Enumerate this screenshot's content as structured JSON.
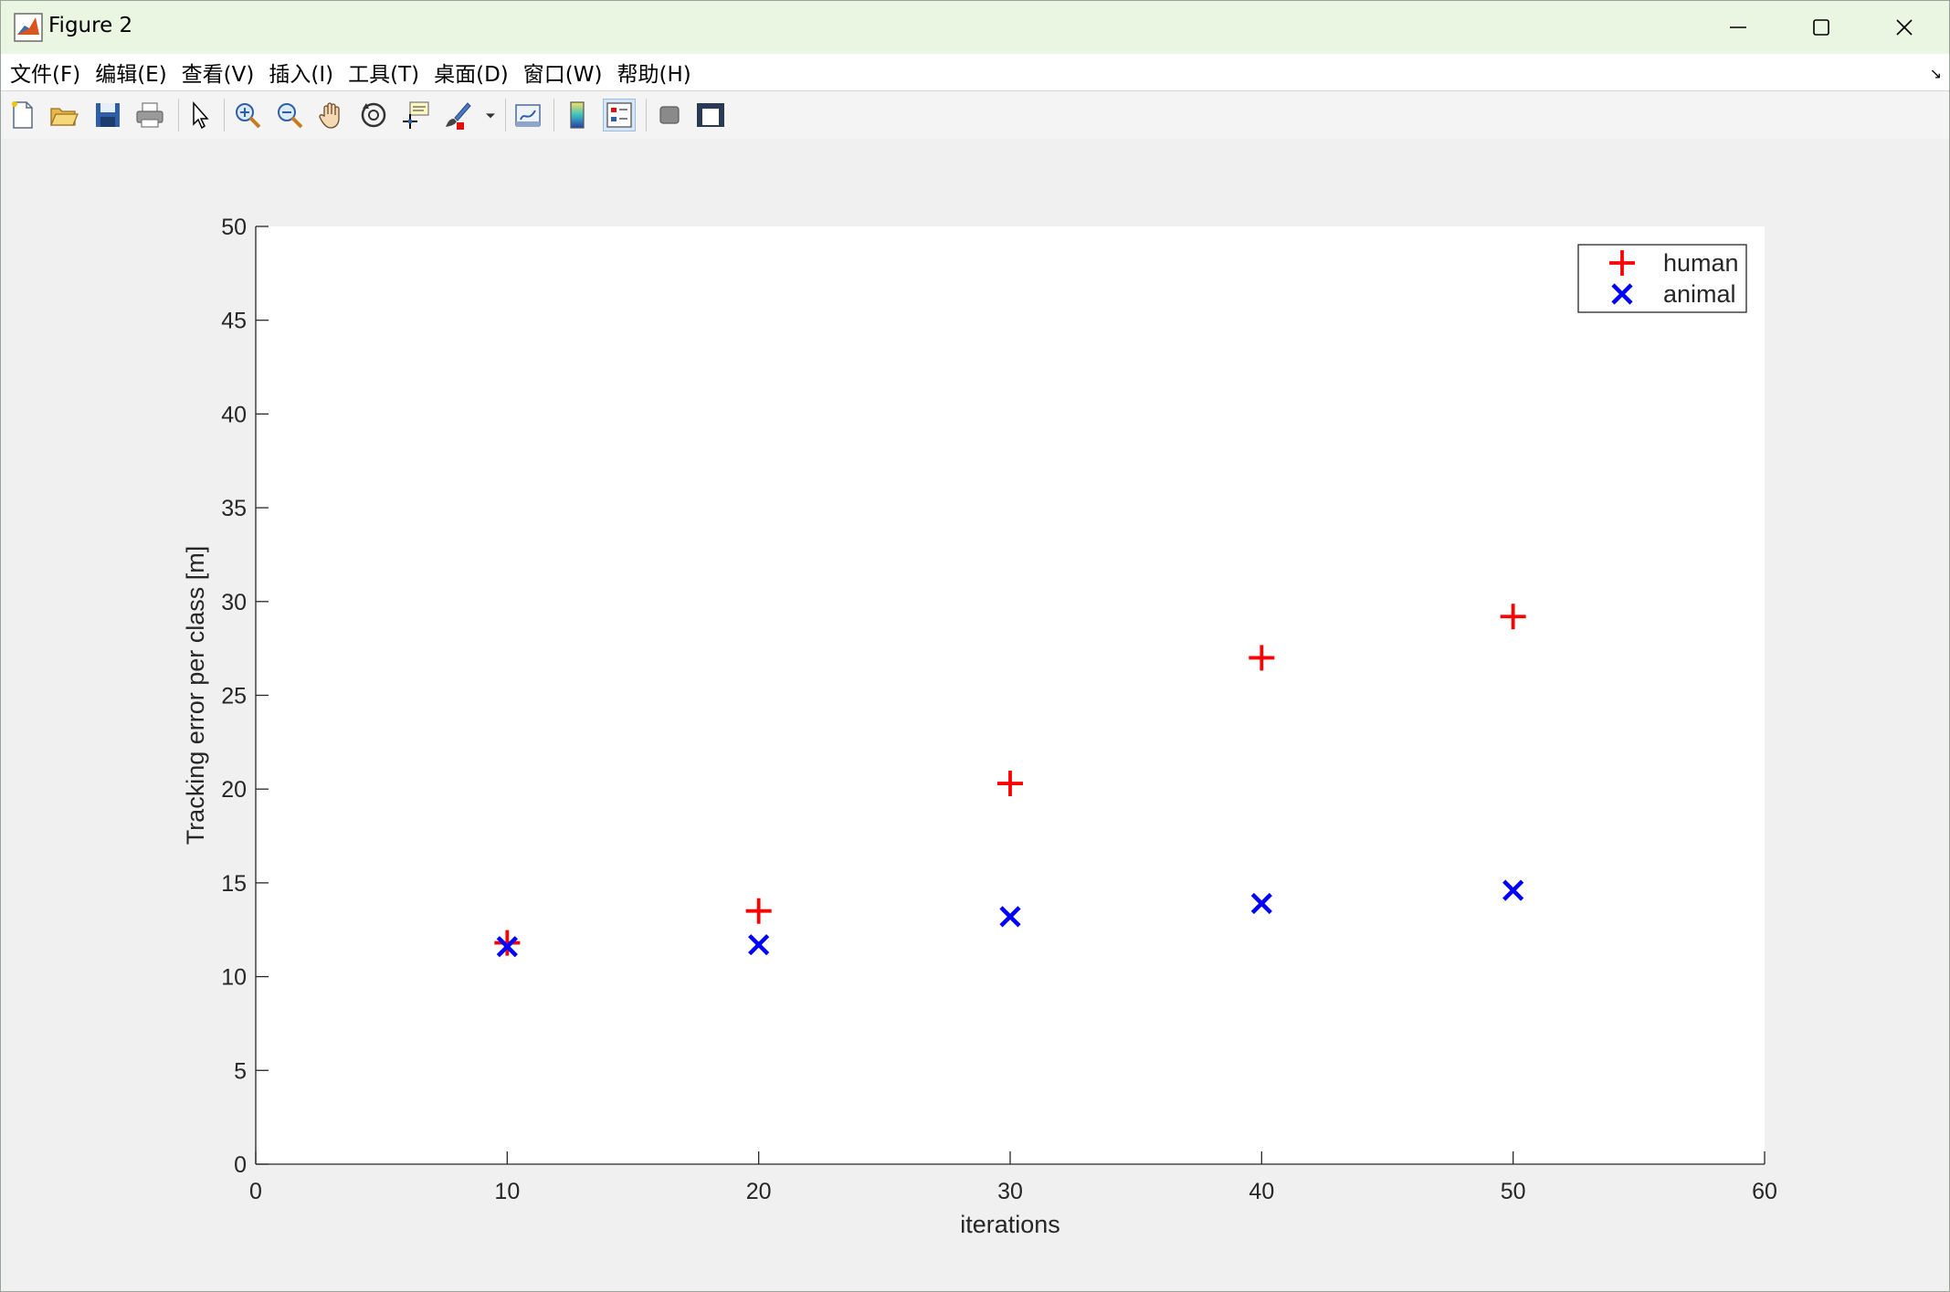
{
  "window": {
    "title": "Figure 2",
    "minimize_icon": "minimize-icon",
    "maximize_icon": "maximize-icon",
    "close_icon": "close-icon"
  },
  "menu": {
    "items": [
      {
        "label": "文件(F)"
      },
      {
        "label": "编辑(E)"
      },
      {
        "label": "查看(V)"
      },
      {
        "label": "插入(I)"
      },
      {
        "label": "工具(T)"
      },
      {
        "label": "桌面(D)"
      },
      {
        "label": "窗口(W)"
      },
      {
        "label": "帮助(H)"
      }
    ],
    "corner_glyph": "↘"
  },
  "toolbar": {
    "buttons": [
      {
        "icon": "new-figure-icon"
      },
      {
        "icon": "open-file-icon"
      },
      {
        "icon": "save-icon"
      },
      {
        "icon": "print-icon"
      },
      {
        "icon": "edit-pointer-icon"
      },
      {
        "icon": "zoom-in-icon"
      },
      {
        "icon": "zoom-out-icon"
      },
      {
        "icon": "pan-hand-icon"
      },
      {
        "icon": "rotate-3d-icon"
      },
      {
        "icon": "data-cursor-icon"
      },
      {
        "icon": "brush-icon"
      },
      {
        "icon": "link-plot-icon"
      },
      {
        "icon": "colorbar-icon"
      },
      {
        "icon": "legend-icon"
      },
      {
        "icon": "hide-plot-tools-icon"
      },
      {
        "icon": "show-plot-tools-icon"
      }
    ]
  },
  "chart_data": {
    "type": "scatter",
    "xlabel": "iterations",
    "ylabel": "Tracking error per class [m]",
    "xlim": [
      0,
      60
    ],
    "ylim": [
      0,
      50
    ],
    "xticks": [
      0,
      10,
      20,
      30,
      40,
      50,
      60
    ],
    "yticks": [
      0,
      5,
      10,
      15,
      20,
      25,
      30,
      35,
      40,
      45,
      50
    ],
    "grid": false,
    "legend": "top-right",
    "series": [
      {
        "name": "human",
        "marker": "+",
        "color": "#ff0000",
        "x": [
          10,
          20,
          30,
          40,
          50
        ],
        "y": [
          11.8,
          13.5,
          20.3,
          27.0,
          29.2
        ]
      },
      {
        "name": "animal",
        "marker": "x",
        "color": "#0000ff",
        "x": [
          10,
          20,
          30,
          40,
          50
        ],
        "y": [
          11.6,
          11.7,
          13.2,
          13.9,
          14.6
        ]
      }
    ]
  }
}
